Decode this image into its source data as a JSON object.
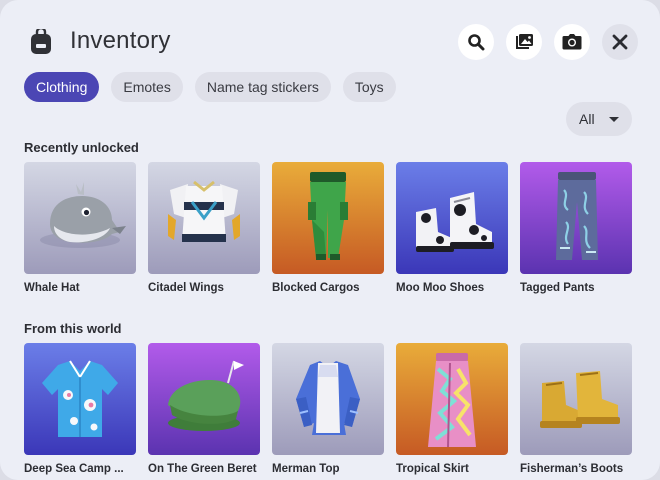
{
  "header": {
    "title": "Inventory"
  },
  "tabs": [
    {
      "label": "Clothing",
      "active": true
    },
    {
      "label": "Emotes",
      "active": false
    },
    {
      "label": "Name tag stickers",
      "active": false
    },
    {
      "label": "Toys",
      "active": false
    }
  ],
  "filter": {
    "selected": "All"
  },
  "sections": [
    {
      "title": "Recently unlocked",
      "items": [
        {
          "name": "Whale Hat",
          "background": "gray"
        },
        {
          "name": "Citadel Wings",
          "background": "gray"
        },
        {
          "name": "Blocked Cargos",
          "background": "orange"
        },
        {
          "name": "Moo Moo Shoes",
          "background": "blue"
        },
        {
          "name": "Tagged Pants",
          "background": "purple"
        }
      ]
    },
    {
      "title": "From this world",
      "items": [
        {
          "name": "Deep Sea Camp ...",
          "background": "blue"
        },
        {
          "name": "On The Green Beret",
          "background": "purple"
        },
        {
          "name": "Merman Top",
          "background": "gray"
        },
        {
          "name": "Tropical Skirt",
          "background": "orange"
        },
        {
          "name": "Fisherman’s Boots",
          "background": "gray"
        }
      ]
    }
  ],
  "colors": {
    "accent": "#4b46b4",
    "panel": "#eceef6",
    "chip": "#dfe0e9"
  },
  "icons": [
    "backpack-icon",
    "search-icon",
    "gallery-icon",
    "camera-icon",
    "close-icon",
    "caret-down-icon"
  ]
}
